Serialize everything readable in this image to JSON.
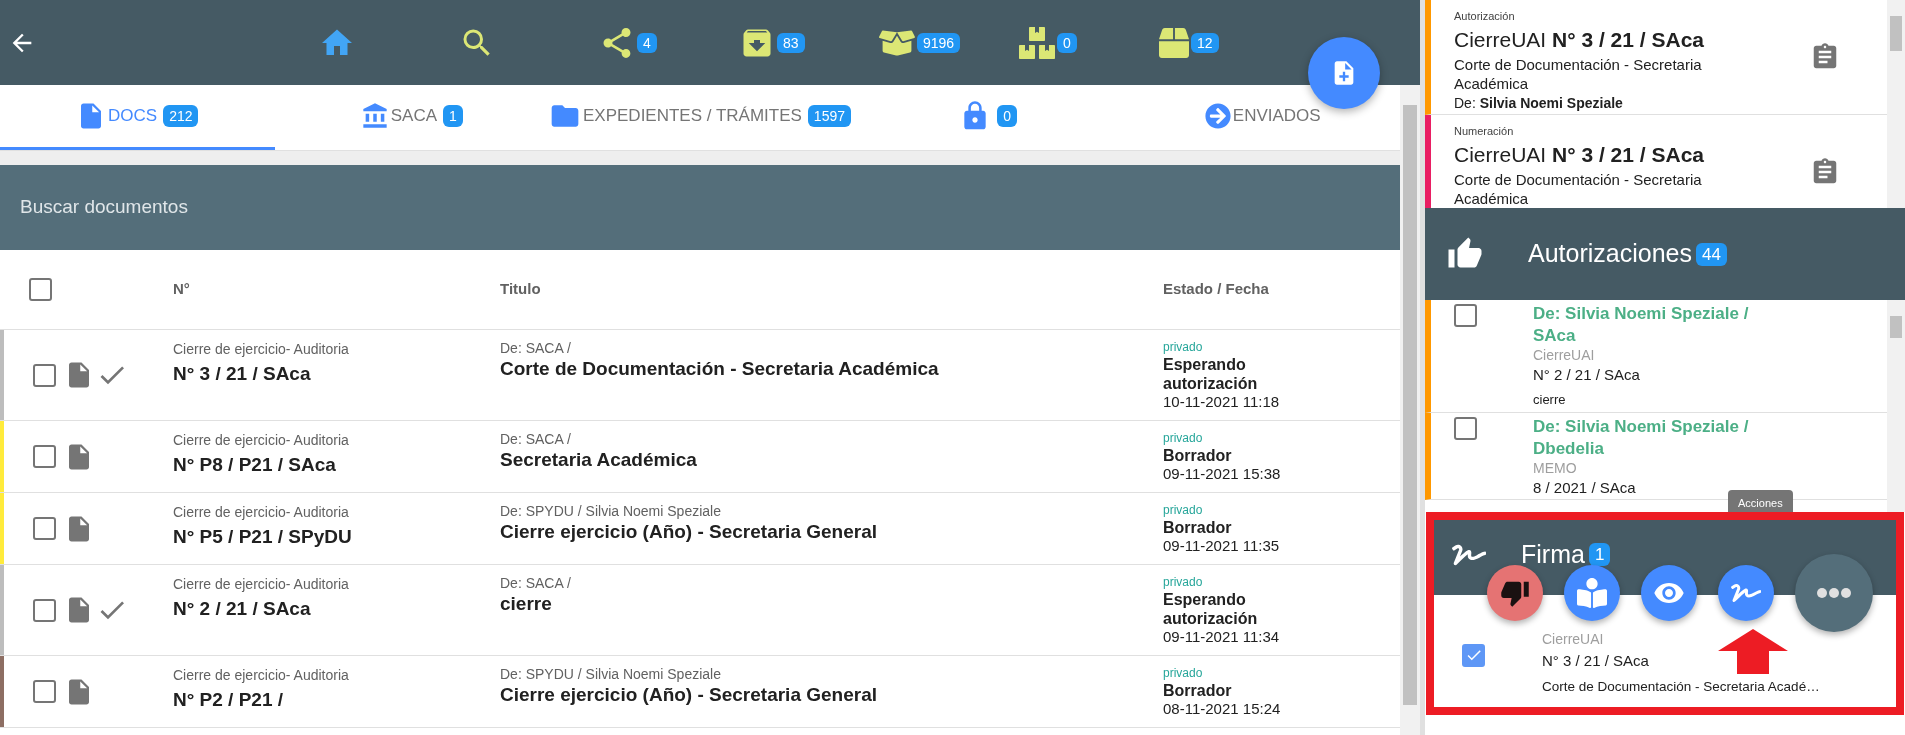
{
  "top_bar": {
    "items": [
      {
        "kind": "home"
      },
      {
        "kind": "search"
      },
      {
        "kind": "share",
        "badge": "4"
      },
      {
        "kind": "archive",
        "badge": "83"
      },
      {
        "kind": "open_box",
        "badge": "9196"
      },
      {
        "kind": "boxes",
        "badge": "0"
      },
      {
        "kind": "box",
        "badge": "12"
      }
    ]
  },
  "tabs": [
    {
      "kind": "docs",
      "label": "DOCS",
      "badge": "212",
      "selected": true
    },
    {
      "kind": "saca",
      "label": "SACA",
      "badge": "1",
      "selected": false
    },
    {
      "kind": "folder",
      "label": "EXPEDIENTES / TRÁMITES",
      "badge": "1597",
      "selected": false
    },
    {
      "kind": "lock",
      "badge": "0",
      "selected": false
    },
    {
      "kind": "sent",
      "label": "ENVIADOS",
      "selected": false
    }
  ],
  "search": {
    "placeholder": "Buscar documentos"
  },
  "table": {
    "select_all": {
      "checked": false
    },
    "columns": [
      "N°",
      "Titulo",
      "Estado / Fecha"
    ],
    "rows": [
      {
        "color": "#bdbdbd",
        "checked": false,
        "signed": true,
        "type": "Cierre de ejercicio- Auditoria",
        "number": "N° 3 / 21 / SAca",
        "from": "De: SACA /",
        "title": "Corte de Documentación - Secretaria Académica",
        "privacy": "privado",
        "status": "Esperando autorización",
        "date": "10-11-2021 11:18"
      },
      {
        "color": "#ffeb3b",
        "checked": false,
        "signed": false,
        "type": "Cierre de ejercicio- Auditoria",
        "number": "N° P8 / P21 / SAca",
        "from": "De: SACA /",
        "title": "Secretaria Académica",
        "privacy": "privado",
        "status": "Borrador",
        "date": "09-11-2021 15:38"
      },
      {
        "color": "#ffeb3b",
        "checked": false,
        "signed": false,
        "type": "Cierre de ejercicio- Auditoria",
        "number": "N° P5 / P21 / SPyDU",
        "from": "De: SPYDU / Silvia Noemi Speziale",
        "title": "Cierre ejercicio (Año) - Secretaria General",
        "privacy": "privado",
        "status": "Borrador",
        "date": "09-11-2021 11:35"
      },
      {
        "color": "#bdbdbd",
        "checked": false,
        "signed": true,
        "type": "Cierre de ejercicio- Auditoria",
        "number": "N° 2 / 21 / SAca",
        "from": "De: SACA /",
        "title": "cierre",
        "privacy": "privado",
        "status": "Esperando autorización",
        "date": "09-11-2021 11:34"
      },
      {
        "color": "#8d6e63",
        "checked": false,
        "signed": false,
        "type": "Cierre de ejercicio- Auditoria",
        "number": "N° P2 / P21 /",
        "from": "De: SPYDU / Silvia Noemi Speziale",
        "title": "Cierre ejercicio (Año) - Secretaria General",
        "privacy": "privado",
        "status": "Borrador",
        "date": "08-11-2021 15:24"
      }
    ]
  },
  "notifications": [
    {
      "color": "#ff9800",
      "label": "Autorización",
      "title": "CierreUAI **N° 3 / 21 / SAca**",
      "subtitle": "Corte de Documentación - Secretaria Académica",
      "from": "De: **Silvia Noemi Speziale**"
    },
    {
      "color": "#e91e63",
      "label": "Numeración",
      "title": "CierreUAI **N° 3 / 21 / SAca**",
      "subtitle": "Corte de Documentación - Secretaria Académica"
    }
  ],
  "authorizations": {
    "title": "Autorizaciones",
    "badge": "44",
    "items": [
      {
        "color": "#ff9800",
        "checked": false,
        "heading": "De: Silvia Noemi Speziale / SAca",
        "type": "CierreUAI",
        "number": "N° 2 / 21 / SAca",
        "note": "cierre"
      },
      {
        "color": "#ff9800",
        "checked": false,
        "heading": "De: Silvia Noemi Speziale / Dbedelia",
        "type": "MEMO",
        "number": "8 / 2021 / SAca"
      }
    ]
  },
  "tooltip": "Acciones",
  "signature": {
    "title": "Firma",
    "badge": "1",
    "actions": [
      {
        "kind": "reject"
      },
      {
        "kind": "read"
      },
      {
        "kind": "view"
      },
      {
        "kind": "sign"
      },
      {
        "kind": "more"
      }
    ],
    "items": [
      {
        "checked": true,
        "type": "CierreUAI",
        "number": "N° 3 / 21 / SAca",
        "title": "Corte de Documentación - Secretaria Acadé…"
      }
    ]
  }
}
